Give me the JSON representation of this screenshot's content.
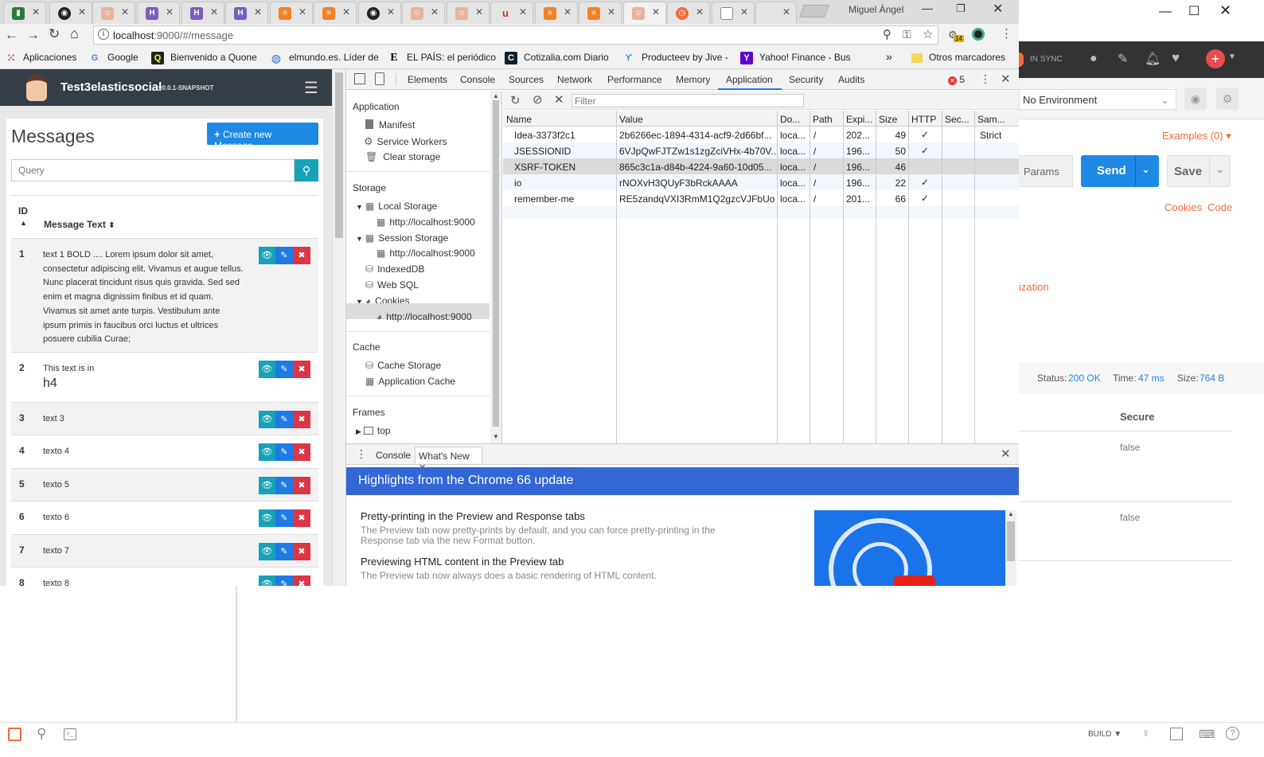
{
  "window": {
    "user": "Miguel Ángel"
  },
  "browser": {
    "url_host": "localhost",
    "url_rest": ":9000/#/message",
    "extension_badge": "14",
    "bookmarks": [
      "Aplicaciones",
      "Google",
      "Bienvenido a Quone",
      "elmundo.es. Líder de",
      "EL PAÍS: el periódico",
      "Cotizalia.com Diario",
      "Producteev by Jive -",
      "Yahoo! Finance - Bus",
      "Otros marcadores"
    ],
    "bookmarks_more": "»"
  },
  "app": {
    "brand": "Test3elasticsocial",
    "version": "v0.0.1-SNAPSHOT",
    "heading": "Messages",
    "create_button": "Create new Message",
    "search_placeholder": "Query",
    "col_id": "ID",
    "col_text": "Message Text",
    "rows": [
      {
        "id": "1",
        "text": "text 1 BOLD .... Lorem ipsum dolor sit amet, consectetur adipiscing elit. Vivamus et augue tellus. Nunc placerat tincidunt risus quis gravida. Sed sed enim et magna dignissim finibus et id quam. Vivamus sit amet ante turpis. Vestibulum ante ipsum primis in faucibus orci luctus et ultrices posuere cubilia Curae;"
      },
      {
        "id": "2",
        "text": "This text is in",
        "text_h4": "h4"
      },
      {
        "id": "3",
        "text": "text 3"
      },
      {
        "id": "4",
        "text": "texto 4"
      },
      {
        "id": "5",
        "text": "texto 5"
      },
      {
        "id": "6",
        "text": "texto 6"
      },
      {
        "id": "7",
        "text": "texto 7"
      },
      {
        "id": "8",
        "text": "texto 8"
      }
    ]
  },
  "devtools": {
    "tabs": [
      "Elements",
      "Console",
      "Sources",
      "Network",
      "Performance",
      "Memory",
      "Application",
      "Security",
      "Audits"
    ],
    "active_tab": "Application",
    "error_count": "5",
    "sidebar": {
      "application_header": "Application",
      "manifest": "Manifest",
      "service_workers": "Service Workers",
      "clear_storage": "Clear storage",
      "storage_header": "Storage",
      "local_storage": "Local Storage",
      "local_storage_origin": "http://localhost:9000",
      "session_storage": "Session Storage",
      "session_storage_origin": "http://localhost:9000",
      "indexeddb": "IndexedDB",
      "websql": "Web SQL",
      "cookies": "Cookies",
      "cookies_origin": "http://localhost:9000",
      "cache_header": "Cache",
      "cache_storage": "Cache Storage",
      "application_cache": "Application Cache",
      "frames_header": "Frames",
      "frames_top": "top"
    },
    "filter_placeholder": "Filter",
    "cookie_columns": [
      "Name",
      "Value",
      "Do...",
      "Path",
      "Expi...",
      "Size",
      "HTTP",
      "Sec...",
      "Sam..."
    ],
    "cookies": [
      {
        "name": "Idea-3373f2c1",
        "value": "2b6266ec-1894-4314-acf9-2d66bf...",
        "domain": "loca...",
        "path": "/",
        "expires": "202...",
        "size": "49",
        "http": "✓",
        "secure": "",
        "same": "Strict"
      },
      {
        "name": "JSESSIONID",
        "value": "6VJpQwFJTZw1s1zgZciVHx-4b70V...",
        "domain": "loca...",
        "path": "/",
        "expires": "196...",
        "size": "50",
        "http": "✓",
        "secure": "",
        "same": ""
      },
      {
        "name": "XSRF-TOKEN",
        "value": "865c3c1a-d84b-4224-9a60-10d05...",
        "domain": "loca...",
        "path": "/",
        "expires": "196...",
        "size": "46",
        "http": "",
        "secure": "",
        "same": ""
      },
      {
        "name": "io",
        "value": "rNOXvH3QUyF3bRckAAAA",
        "domain": "loca...",
        "path": "/",
        "expires": "196...",
        "size": "22",
        "http": "✓",
        "secure": "",
        "same": ""
      },
      {
        "name": "remember-me",
        "value": "RE5zandqVXI3RmM1Q2gzcVJFbUo...",
        "domain": "loca...",
        "path": "/",
        "expires": "201...",
        "size": "66",
        "http": "✓",
        "secure": "",
        "same": ""
      }
    ],
    "drawer": {
      "tab_console": "Console",
      "tab_whatsnew": "What's New",
      "banner": "Highlights from the Chrome 66 update",
      "items": [
        {
          "title": "Pretty-printing in the Preview and Response tabs",
          "desc": "The Preview tab now pretty-prints by default, and you can force pretty-printing in the Response tab via the new Format button."
        },
        {
          "title": "Previewing HTML content in the Preview tab",
          "desc": "The Preview tab now always does a basic rendering of HTML content."
        }
      ]
    }
  },
  "postman": {
    "sync": "IN SYNC",
    "environment": "No Environment",
    "examples": "Examples (0)",
    "params": "Params",
    "send": "Send",
    "save": "Save",
    "cookies_link": "Cookies",
    "code_link": "Code",
    "auth_partial": "ization",
    "status_label": "Status:",
    "status_value": "200 OK",
    "time_label": "Time:",
    "time_value": "47 ms",
    "size_label": "Size:",
    "size_value": "764 B",
    "secure_header": "Secure",
    "secure_values": [
      "false",
      "false"
    ],
    "build": "BUILD"
  },
  "colors": {
    "accent_blue": "#1e88e5",
    "postman_orange": "#f26b3a",
    "navbar": "#353d47",
    "devtools_banner": "#3367d6"
  }
}
